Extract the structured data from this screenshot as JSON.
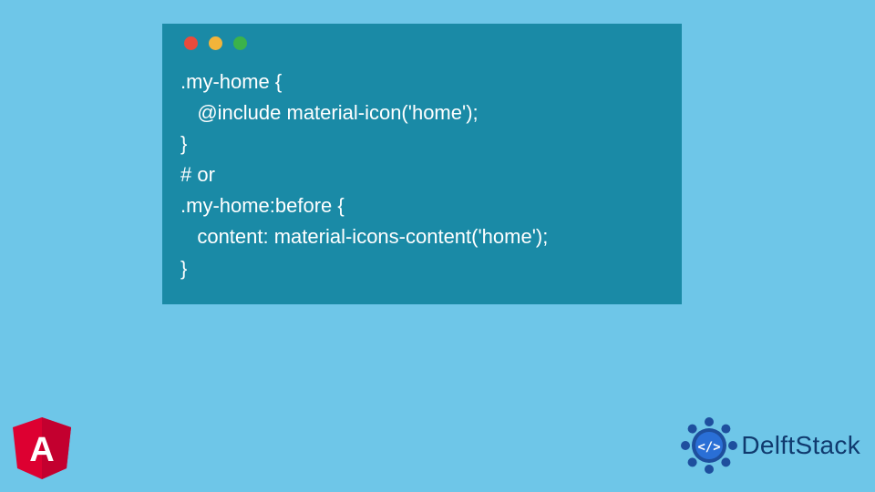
{
  "code": {
    "line1": ".my-home {",
    "line2": "   @include material-icon('home');",
    "line3": "}",
    "line4": "# or",
    "line5": ".my-home:before {",
    "line6": "   content: material-icons-content('home');",
    "line7": "}"
  },
  "brand": {
    "name": "DelftStack",
    "angular_letter": "A"
  }
}
